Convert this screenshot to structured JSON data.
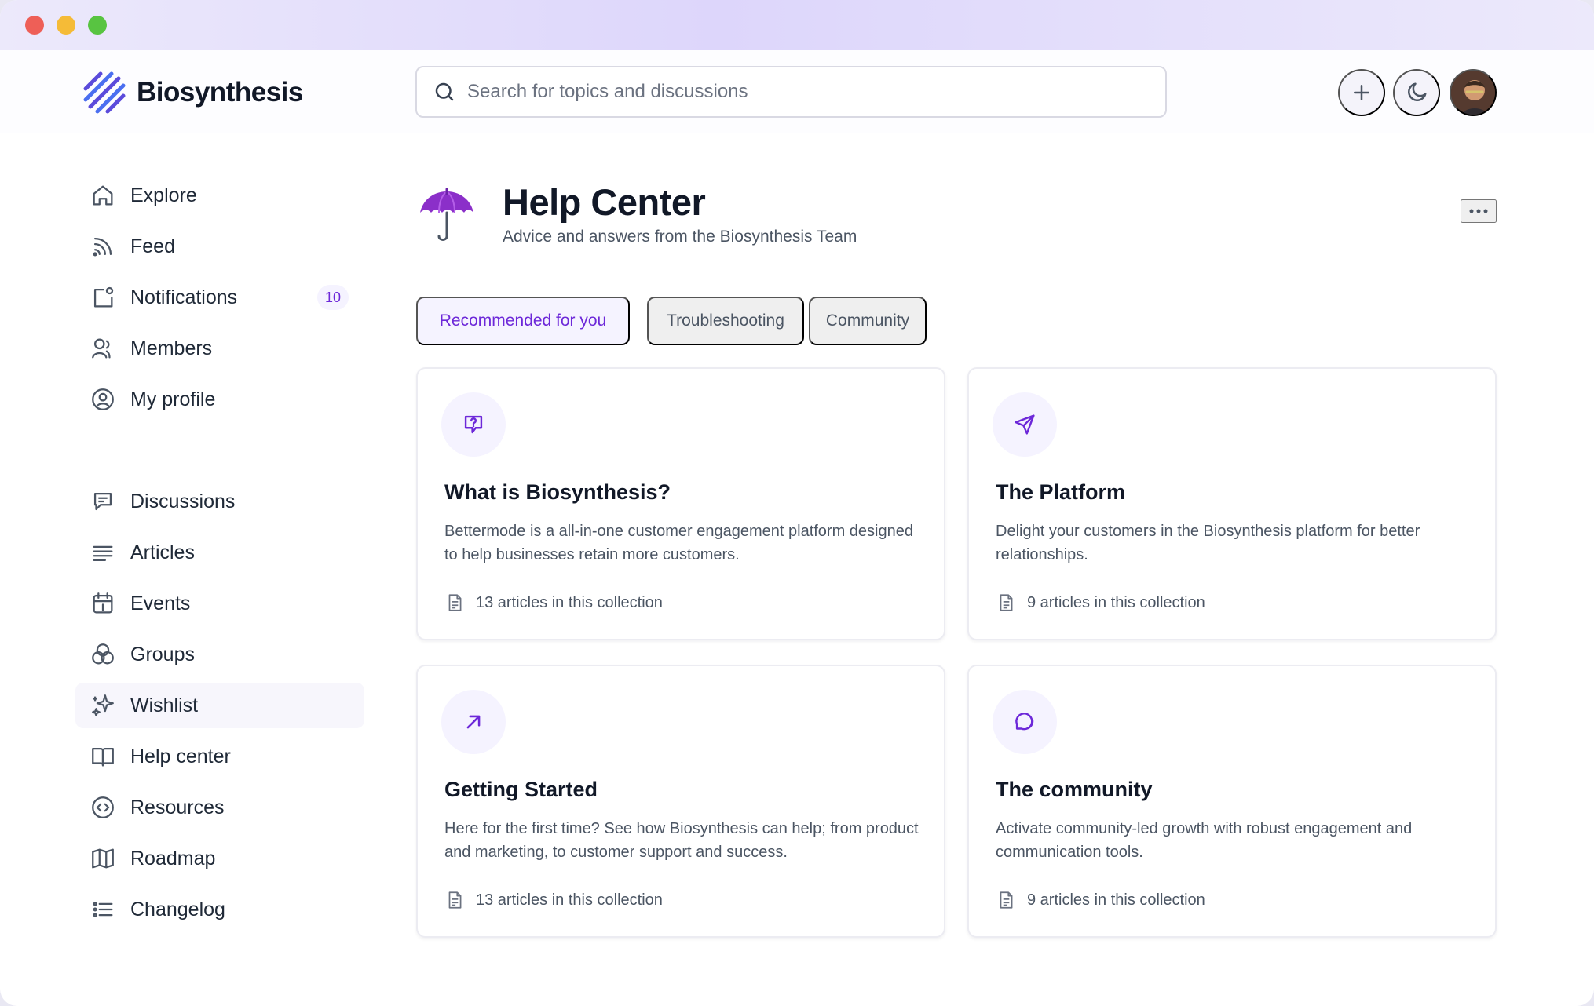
{
  "window": {
    "controls": [
      "close",
      "minimize",
      "maximize"
    ]
  },
  "brand": {
    "name": "Biosynthesis",
    "logo_icon": "diagonal-stripes-logo",
    "accent_color": "#5b4bdb"
  },
  "search": {
    "placeholder": "Search for topics and discussions",
    "icon": "search-icon"
  },
  "header_actions": {
    "add_icon": "plus-icon",
    "theme_icon": "moon-icon",
    "avatar_icon": "user-avatar"
  },
  "sidebar": {
    "primary": [
      {
        "label": "Explore",
        "icon": "home-icon"
      },
      {
        "label": "Feed",
        "icon": "rss-icon"
      },
      {
        "label": "Notifications",
        "icon": "notification-icon",
        "badge": "10"
      },
      {
        "label": "Members",
        "icon": "members-icon"
      },
      {
        "label": "My profile",
        "icon": "profile-icon"
      }
    ],
    "secondary": [
      {
        "label": "Discussions",
        "icon": "chat-icon"
      },
      {
        "label": "Articles",
        "icon": "text-lines-icon"
      },
      {
        "label": "Events",
        "icon": "calendar-icon"
      },
      {
        "label": "Groups",
        "icon": "groups-icon"
      },
      {
        "label": "Wishlist",
        "icon": "sparkles-icon",
        "active": true
      },
      {
        "label": "Help center",
        "icon": "book-icon"
      },
      {
        "label": "Resources",
        "icon": "code-icon"
      },
      {
        "label": "Roadmap",
        "icon": "map-icon"
      },
      {
        "label": "Changelog",
        "icon": "list-icon"
      }
    ]
  },
  "page": {
    "emoji_icon": "umbrella-icon",
    "title": "Help Center",
    "subtitle": "Advice and answers from the Biosynthesis Team",
    "more_icon": "more-horizontal-icon"
  },
  "tabs": [
    {
      "label": "Recommended for you",
      "active": true
    },
    {
      "label": "Troubleshooting",
      "active": false
    },
    {
      "label": "Community",
      "active": false
    }
  ],
  "cards": [
    {
      "icon": "help-chat-icon",
      "title": "What is Biosynthesis?",
      "description": "Bettermode is a all-in-one customer engagement platform designed to help businesses retain more customers.",
      "meta": "13 articles in this collection"
    },
    {
      "icon": "send-icon",
      "title": "The Platform",
      "description": "Delight your customers in the Biosynthesis platform for better relationships.",
      "meta": "9 articles in this collection"
    },
    {
      "icon": "arrow-up-right-icon",
      "title": "Getting Started",
      "description": "Here for the first time? See how Biosynthesis can help; from product and marketing, to customer support and success.",
      "meta": "13 articles in this collection"
    },
    {
      "icon": "community-chat-icon",
      "title": "The community",
      "description": "Activate community-led growth with robust engagement and communication tools.",
      "meta": "9 articles in this collection"
    }
  ],
  "colors": {
    "accent": "#6d28d9",
    "accent_soft": "#f5f3ff",
    "text": "#111827",
    "muted_text": "#4b5563"
  }
}
